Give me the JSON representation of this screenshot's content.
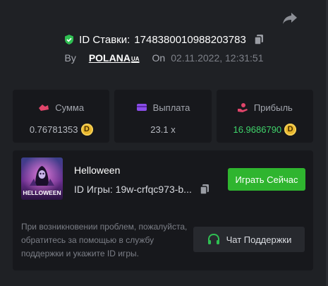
{
  "bet": {
    "label": "ID Ставки:",
    "id": "1748380010988203783"
  },
  "by": {
    "label": "By",
    "user": "POLANA",
    "user_suffix": "UA",
    "on_label": "On",
    "date": "02.11.2022, 12:31:51"
  },
  "stats": [
    {
      "label": "Сумма",
      "value": "0.76781353",
      "icon": "cash-icon",
      "color": "#e0456a"
    },
    {
      "label": "Выплата",
      "value": "23.1 x",
      "icon": "card-icon",
      "color": "#8a4de8"
    },
    {
      "label": "Прибыль",
      "value": "16.9686790",
      "icon": "hand-coin-icon",
      "color": "#e0456a"
    }
  ],
  "coin_symbol": "D",
  "game": {
    "title": "Helloween",
    "id_label": "ID Игры: 19w-crfqc973-b...",
    "thumb_text": "HELLOWEEN",
    "play_label": "Играть Сейчас"
  },
  "help": {
    "text": "При возникновении проблем, пожалуйста, обратитесь за помощью в службу поддержки и укажите ID игры.",
    "support_label": "Чат Поддержки"
  },
  "colors": {
    "background": "#1f2125",
    "card": "#17181c",
    "accent_green": "#2fb52f",
    "profit_green": "#3fd36a",
    "coin": "#e8b62c"
  }
}
